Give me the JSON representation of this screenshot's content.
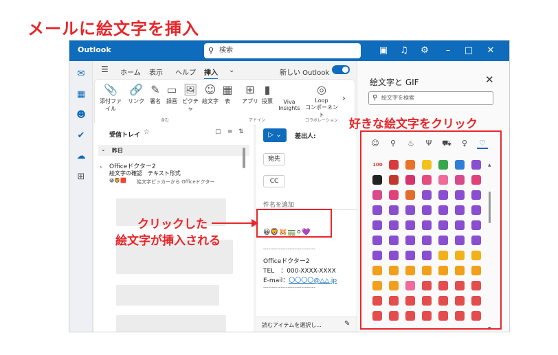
{
  "headline": "メールに絵文字を挿入",
  "callouts": {
    "click_emoji": "好きな絵文字をクリック",
    "inserted_line1": "クリックした",
    "inserted_line2": "絵文字が挿入される"
  },
  "titlebar": {
    "app_name": "Outlook",
    "search_placeholder": "検索"
  },
  "ribbon": {
    "tabs": [
      "ホーム",
      "表示",
      "ヘルプ",
      "挿入"
    ],
    "new_outlook_label": "新しい Outlook",
    "buttons": [
      {
        "label": "添付ファイル",
        "icon": "paperclip-icon",
        "glyph": "📎"
      },
      {
        "label": "リンク",
        "icon": "link-icon",
        "glyph": "🔗"
      },
      {
        "label": "署名",
        "icon": "signature-icon",
        "glyph": "✎"
      },
      {
        "label": "録画",
        "icon": "video-icon",
        "glyph": "▭"
      },
      {
        "label": "ピクチャ",
        "icon": "picture-icon",
        "glyph": "🖼"
      },
      {
        "label": "絵文字",
        "icon": "emoji-icon",
        "glyph": "☺"
      },
      {
        "label": "表",
        "icon": "table-icon",
        "glyph": "▦"
      },
      {
        "label": "アプリ",
        "icon": "apps-icon",
        "glyph": "⊞"
      },
      {
        "label": "投票",
        "icon": "poll-icon",
        "glyph": "▮"
      },
      {
        "label": "Viva\nInsights",
        "icon": "viva-insights-icon",
        "glyph": ""
      },
      {
        "label": "Loop\nコンポーネント",
        "icon": "loop-icon",
        "glyph": "◎"
      }
    ],
    "groups": [
      "含む",
      "アドイン",
      "コラボレーション"
    ]
  },
  "maillist": {
    "folder": "受信トレイ",
    "group": "昨日",
    "item": {
      "sender": "Officeドクター2",
      "subject": "絵文字の確認　テキスト形式",
      "preview": "絵文字ピッカーから Officeドクター"
    }
  },
  "compose": {
    "sender_label": "差出人:",
    "to_label": "宛先",
    "cc_label": "CC",
    "subject_placeholder": "件名を追加",
    "inserted_emojis": "😀🦁🐹🚃⚪💜",
    "divider": "------------------------------",
    "signature_name": "Officeドクター2",
    "signature_tel": "TEL　：000-XXXX-XXXX",
    "signature_email_label": "E-mail：",
    "signature_email": "〇〇〇〇@△△.jp",
    "status_text": "読むアイテムを選択し..."
  },
  "emoji_panel": {
    "title": "絵文字と GIF",
    "search_placeholder": "絵文字を検索",
    "categories": [
      {
        "icon": "smiley-icon",
        "glyph": "☺"
      },
      {
        "icon": "people-icon",
        "glyph": "⚲"
      },
      {
        "icon": "nature-icon",
        "glyph": "♨"
      },
      {
        "icon": "food-icon",
        "glyph": "Ψ"
      },
      {
        "icon": "travel-icon",
        "glyph": "⛟"
      },
      {
        "icon": "objects-icon",
        "glyph": "♀"
      },
      {
        "icon": "heart-icon",
        "glyph": "♡"
      }
    ],
    "grid": [
      [
        "100",
        "#d83b3b",
        "#e8742a",
        "#f2c21b",
        "#3aa64c",
        "#2f7fd8",
        "#8a4fd0"
      ],
      [
        "#222222",
        "#c0392b",
        "#d6336c",
        "#e34d80",
        "#f06b9a",
        "#d94a8c",
        "#e0417a"
      ],
      [
        "#d94a8c",
        "#e0417a",
        "#e36c2b",
        "#8a4fd0",
        "#8a4fd0",
        "#8a4fd0",
        "#8a4fd0"
      ],
      [
        "#8a4fd0",
        "#8a4fd0",
        "#8a4fd0",
        "#8a4fd0",
        "#8a4fd0",
        "#8a4fd0",
        "#8a4fd0"
      ],
      [
        "#8a4fd0",
        "#8a4fd0",
        "#8a4fd0",
        "#8a4fd0",
        "#8a4fd0",
        "#8a4fd0",
        "#8a4fd0"
      ],
      [
        "#8a4fd0",
        "#8a4fd0",
        "#8a4fd0",
        "#8a4fd0",
        "#8a4fd0",
        "#8a4fd0",
        "#8a4fd0"
      ],
      [
        "#8a4fd0",
        "#8a4fd0",
        "#8a4fd0",
        "#8a4fd0",
        "#f2b01b",
        "#f2b01b",
        "#f2b01b"
      ],
      [
        "#f2a01b",
        "#f2a01b",
        "#f2a01b",
        "#f2a01b",
        "#f2a01b",
        "#f2a01b",
        "#f2a01b"
      ],
      [
        "#f2a01b",
        "#f2a01b",
        "#f06b9a",
        "#e34d4d",
        "#e34d4d",
        "#e34d4d",
        "#e34d4d"
      ],
      [
        "#e34d4d",
        "#e34d4d",
        "#e34d4d",
        "#e34d4d",
        "#e34d4d",
        "#e34d4d",
        "#e34d4d"
      ],
      [
        "#e34d4d",
        "#e34d4d",
        "#e34d4d",
        "#e34d4d",
        "#e34d4d",
        "#e34d4d",
        "#e34d4d"
      ]
    ]
  },
  "colors": {
    "accent": "#0f6cbd",
    "annotation": "#e8262a"
  }
}
